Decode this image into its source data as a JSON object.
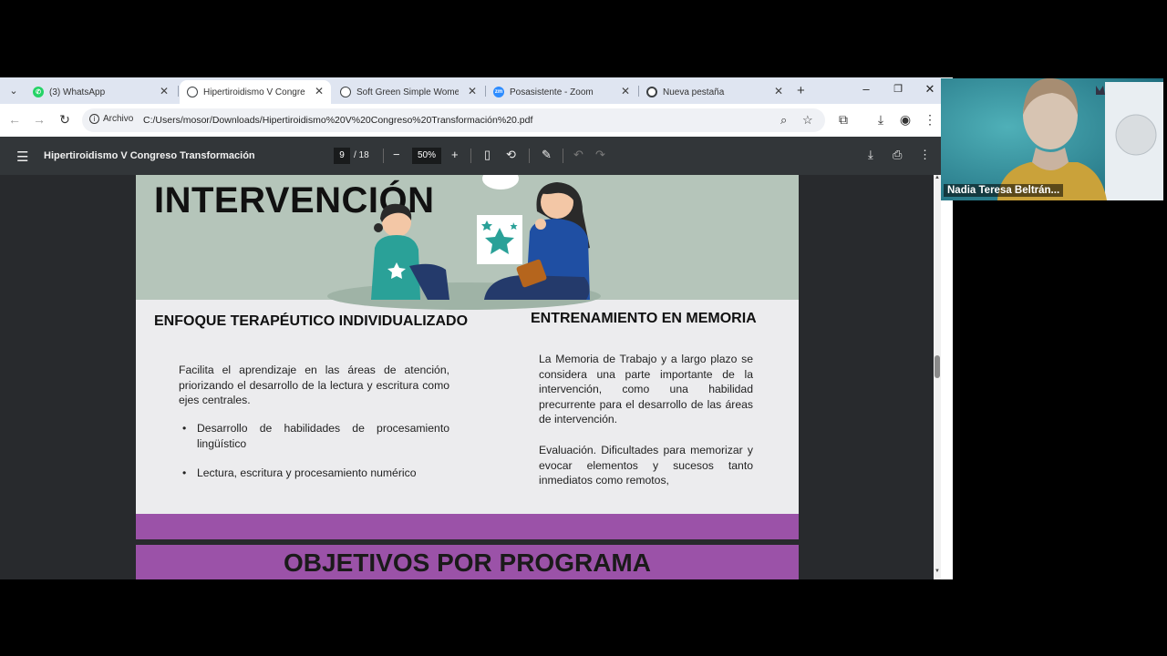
{
  "browser": {
    "tabs": [
      {
        "title": "(3) WhatsApp",
        "favicon": "whatsapp-icon",
        "color": "#25D366",
        "active": false
      },
      {
        "title": "Hipertiroidismo V Congreso",
        "favicon": "globe-icon",
        "color": "#3c4043",
        "active": true
      },
      {
        "title": "Soft Green Simple Women E",
        "favicon": "globe-icon",
        "color": "#3c4043",
        "active": false
      },
      {
        "title": "Posasistente - Zoom",
        "favicon": "zoom-icon",
        "color": "#2D8CFF",
        "active": false
      },
      {
        "title": "Nueva pestaña",
        "favicon": "chrome-icon",
        "color": "#3c4043",
        "active": false
      }
    ],
    "address": {
      "chip": "Archivo",
      "url": "C:/Users/mosor/Downloads/Hipertiroidismo%20V%20Congreso%20Transformación%20.pdf"
    }
  },
  "pdf": {
    "title": "Hipertiroidismo V Congreso Transformación",
    "page_current": "9",
    "page_total": "/ 18",
    "zoom": "50%"
  },
  "slide": {
    "heading": "INTERVENCIÓN",
    "left": {
      "heading": "ENFOQUE TERAPÉUTICO INDIVIDUALIZADO",
      "paragraph": "Facilita el aprendizaje en las áreas de atención, priorizando el desarrollo de la lectura y escritura como ejes centrales.",
      "bullets": [
        "Desarrollo de habilidades de procesamiento lingüístico",
        "Lectura, escritura y procesamiento numérico"
      ]
    },
    "right": {
      "heading": "ENTRENAMIENTO EN MEMORIA",
      "paragraph1": "La Memoria de Trabajo y a largo plazo se considera una parte importante de la intervención, como una habilidad precurrente para el desarrollo de las áreas de intervención.",
      "paragraph2": "Evaluación. Dificultades para memorizar y evocar elementos y sucesos tanto inmediatos como remotos,"
    },
    "colors": {
      "banner": "#b5c5ba",
      "accent_purple": "#9b52a8",
      "teal": "#2aa198"
    }
  },
  "next_slide": {
    "heading": "OBJETIVOS POR PROGRAMA"
  },
  "zoom_tile": {
    "participant_name": "Nadia Teresa Beltrán..."
  }
}
